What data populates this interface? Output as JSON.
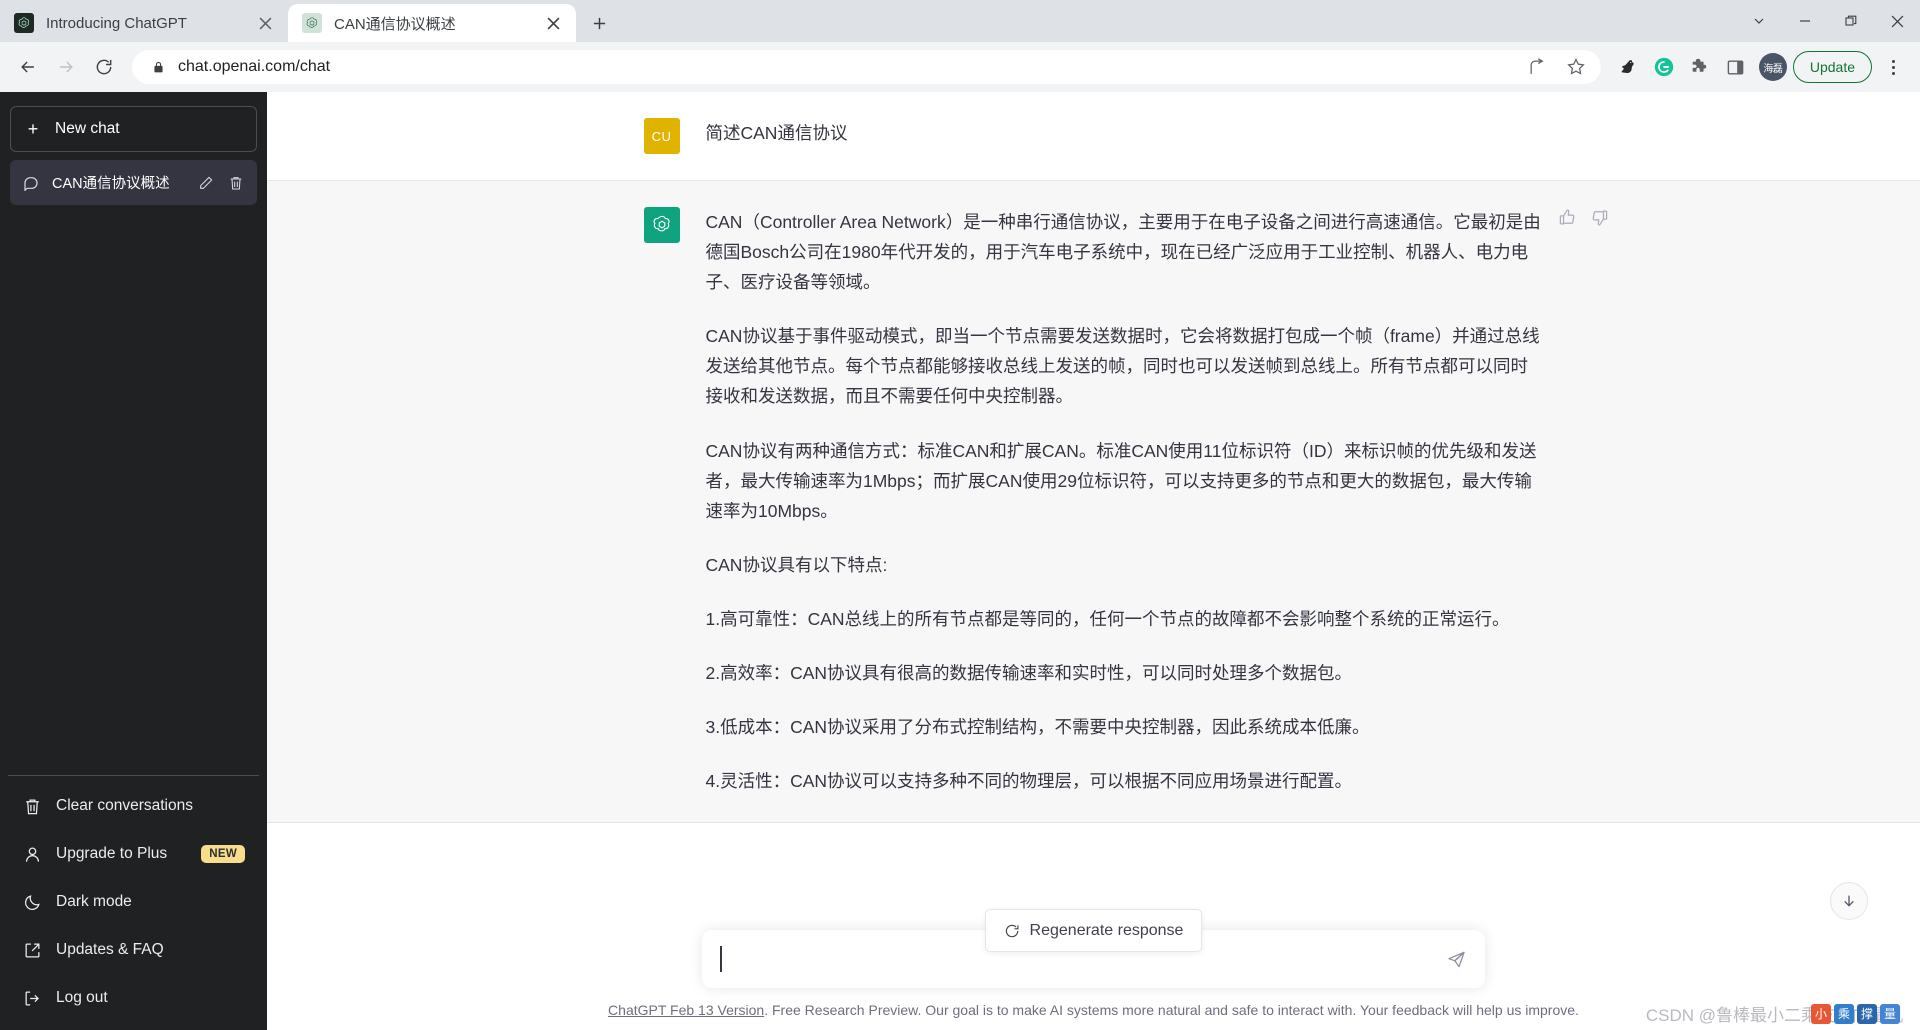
{
  "browser": {
    "tabs": [
      {
        "title": "Introducing ChatGPT",
        "favicon": "chatgpt-icon",
        "active": false
      },
      {
        "title": "CAN通信协议概述",
        "favicon": "chatgpt-icon",
        "active": true
      }
    ],
    "new_tab_label": "+",
    "window_controls": {
      "tab_search": "tab-search-chevron",
      "minimize": "minimize",
      "maximize": "restore",
      "close": "close"
    },
    "toolbar": {
      "back": "back-arrow",
      "forward": "forward-arrow",
      "reload": "reload",
      "url": "chat.openai.com/chat",
      "lock": "lock-icon",
      "share": "share-icon",
      "bookmark": "star-icon",
      "extension_bird": "bird-extension-icon",
      "grammarly": "G",
      "extensions": "puzzle-icon",
      "side_panel": "side-panel-icon",
      "profile_initials": "海磊",
      "update_label": "Update",
      "menu": "kebab-menu"
    }
  },
  "sidebar": {
    "new_chat_label": "New chat",
    "conversations": [
      {
        "title": "CAN通信协议概述",
        "active": true
      }
    ],
    "menu": [
      {
        "label": "Clear conversations",
        "icon": "trash-icon",
        "badge": ""
      },
      {
        "label": "Upgrade to Plus",
        "icon": "person-icon",
        "badge": "NEW"
      },
      {
        "label": "Dark mode",
        "icon": "moon-icon",
        "badge": ""
      },
      {
        "label": "Updates & FAQ",
        "icon": "external-link-icon",
        "badge": ""
      },
      {
        "label": "Log out",
        "icon": "logout-icon",
        "badge": ""
      }
    ]
  },
  "conversation": {
    "user": {
      "avatar_initials": "CU",
      "text": "简述CAN通信协议"
    },
    "assistant": {
      "avatar": "openai-logo",
      "paragraphs": [
        "CAN（Controller Area Network）是一种串行通信协议，主要用于在电子设备之间进行高速通信。它最初是由德国Bosch公司在1980年代开发的，用于汽车电子系统中，现在已经广泛应用于工业控制、机器人、电力电子、医疗设备等领域。",
        "CAN协议基于事件驱动模式，即当一个节点需要发送数据时，它会将数据打包成一个帧（frame）并通过总线发送给其他节点。每个节点都能够接收总线上发送的帧，同时也可以发送帧到总线上。所有节点都可以同时接收和发送数据，而且不需要任何中央控制器。",
        "CAN协议有两种通信方式：标准CAN和扩展CAN。标准CAN使用11位标识符（ID）来标识帧的优先级和发送者，最大传输速率为1Mbps；而扩展CAN使用29位标识符，可以支持更多的节点和更大的数据包，最大传输速率为10Mbps。",
        "CAN协议具有以下特点:",
        "1.高可靠性：CAN总线上的所有节点都是等同的，任何一个节点的故障都不会影响整个系统的正常运行。",
        "2.高效率：CAN协议具有很高的数据传输速率和实时性，可以同时处理多个数据包。",
        "3.低成本：CAN协议采用了分布式控制结构，不需要中央控制器，因此系统成本低廉。",
        "4.灵活性：CAN协议可以支持多种不同的物理层，可以根据不同应用场景进行配置。"
      ],
      "feedback": {
        "thumbs_up": "thumbs-up-icon",
        "thumbs_down": "thumbs-down-icon"
      }
    }
  },
  "regenerate": {
    "label": "Regenerate response",
    "icon": "refresh-icon"
  },
  "scroll_button": {
    "icon": "arrow-down-icon"
  },
  "composer": {
    "value": "",
    "placeholder": "",
    "send_icon": "send-plane-icon"
  },
  "footer": {
    "link_text": "ChatGPT Feb 13 Version",
    "rest_text": ". Free Research Preview. Our goal is to make AI systems more natural and safe to interact with. Your feedback will help us improve."
  },
  "watermark": {
    "text": "CSDN @鲁棒最小二乘支持向量机",
    "overlay_text": "中乘文撑向量机"
  },
  "colors": {
    "accent_green": "#10a37f",
    "sidebar_bg": "#202123",
    "assistant_bg": "#f7f7f8",
    "user_avatar": "#e0b300",
    "badge_new": "#f8dd8b",
    "update_green": "#137333"
  }
}
